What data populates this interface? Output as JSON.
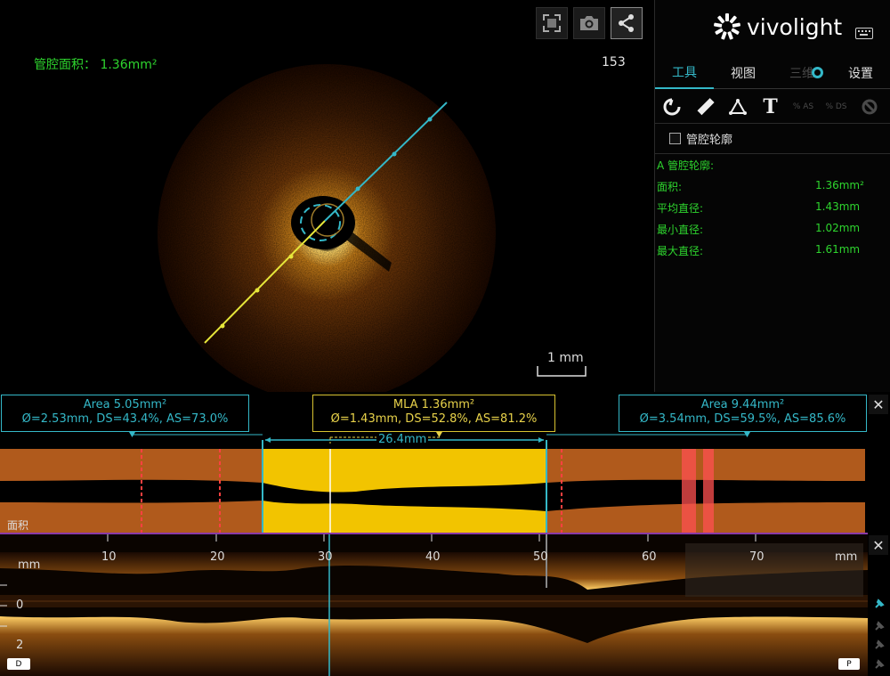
{
  "viewer": {
    "lumen_area_label": "管腔面积： 1.36mm²",
    "frame_number": "153",
    "scale_label": "1 mm",
    "toolbar_icons": [
      "fullscreen-icon",
      "camera-icon",
      "share-icon"
    ]
  },
  "panel": {
    "brand": "vivolight",
    "tabs": [
      {
        "label": "工具",
        "state": "active"
      },
      {
        "label": "视图",
        "state": "normal"
      },
      {
        "label": "三维",
        "state": "disabled"
      },
      {
        "label": "设置",
        "state": "normal"
      }
    ],
    "tools": [
      {
        "name": "lumen-contour-tool-icon",
        "label": ""
      },
      {
        "name": "ruler-tool-icon",
        "label": ""
      },
      {
        "name": "angle-tool-icon",
        "label": ""
      },
      {
        "name": "text-tool-icon",
        "label": "T"
      },
      {
        "name": "area-stenosis-tool-icon",
        "label": "% AS"
      },
      {
        "name": "diameter-stenosis-tool-icon",
        "label": "% DS"
      },
      {
        "name": "clear-tool-icon",
        "label": ""
      }
    ],
    "checkbox_label": "管腔轮廓",
    "results_title": "A 管腔轮廓:",
    "results": [
      {
        "label": "面积:",
        "value": "1.36mm²"
      },
      {
        "label": "平均直径:",
        "value": "1.43mm"
      },
      {
        "label": "最小直径:",
        "value": "1.02mm"
      },
      {
        "label": "最大直径:",
        "value": "1.61mm"
      }
    ]
  },
  "measurements": {
    "left": {
      "line1": "Area 5.05mm²",
      "line2": "Ø=2.53mm, DS=43.4%, AS=73.0%"
    },
    "mla": {
      "line1": "MLA 1.36mm²",
      "line2": "Ø=1.43mm, DS=52.8%, AS=81.2%"
    },
    "right": {
      "line1": "Area 9.44mm²",
      "line2": "Ø=3.54mm, DS=59.5%, AS=85.6%"
    },
    "length_label": "26.4mm"
  },
  "profile": {
    "label": "面积",
    "colors": {
      "vessel": "#b05a1c",
      "segment": "#f2c400",
      "marker": "#ff4040",
      "accent": "#34b8c8"
    }
  },
  "longitudinal": {
    "axis_ticks": [
      "10",
      "20",
      "30",
      "40",
      "50",
      "60",
      "70"
    ],
    "unit_left": "mm",
    "unit_right": "mm",
    "y_labels": [
      "0",
      "2"
    ],
    "end_labels": {
      "distal": "D",
      "proximal": "P"
    }
  },
  "colors": {
    "accent": "#34b8c8",
    "green": "#2ed52e",
    "yellow": "#e8d24a"
  }
}
